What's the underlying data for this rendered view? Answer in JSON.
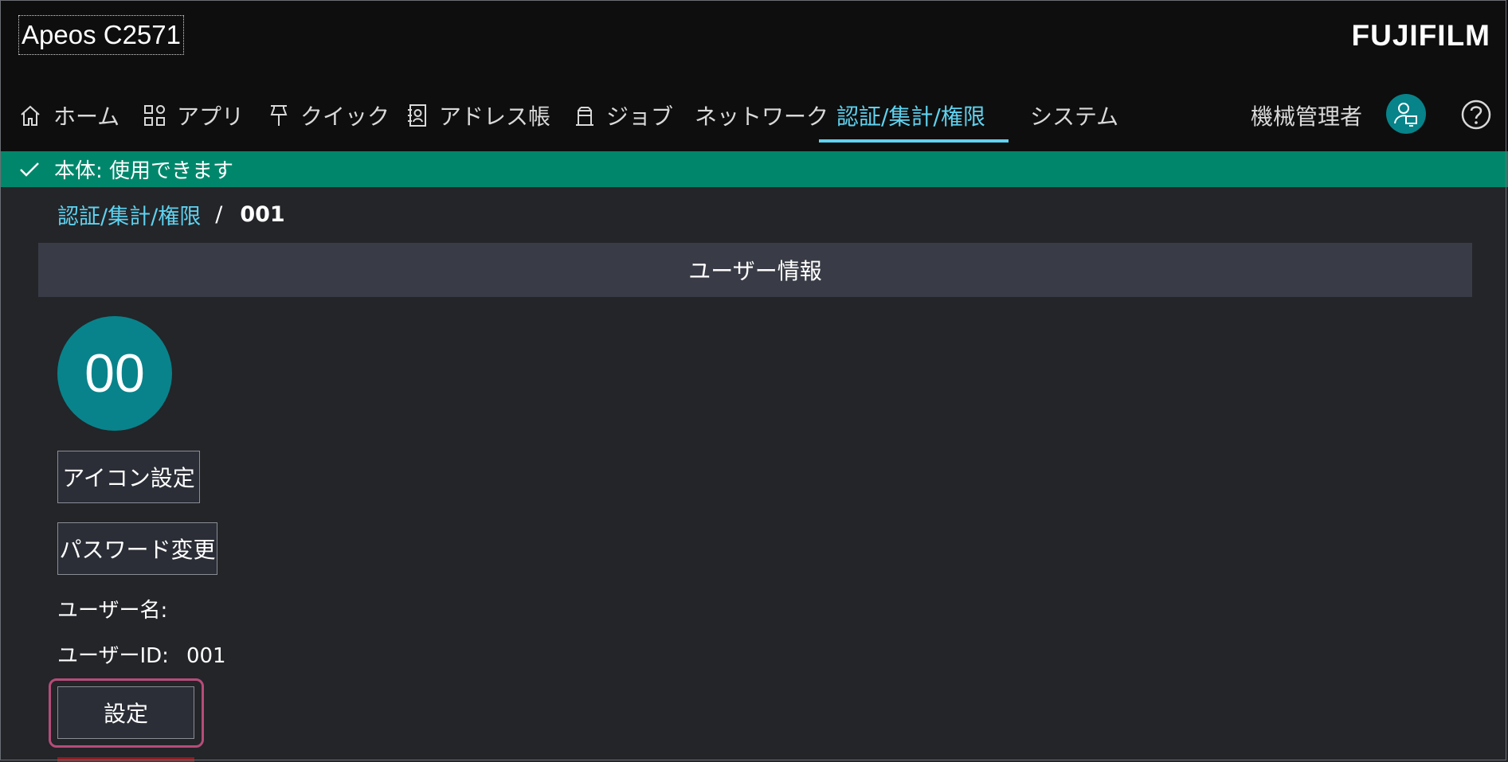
{
  "app": {
    "title": "Apeos C2571",
    "brand": "FUJIFILM"
  },
  "nav": {
    "items": [
      {
        "label": "ホーム",
        "icon": "home-icon"
      },
      {
        "label": "アプリ",
        "icon": "apps-icon"
      },
      {
        "label": "クイック",
        "icon": "pin-icon"
      },
      {
        "label": "アドレス帳",
        "icon": "address-book-icon"
      },
      {
        "label": "ジョブ",
        "icon": "job-icon"
      },
      {
        "label": "ネットワーク"
      },
      {
        "label": "認証/集計/権限",
        "active": true
      },
      {
        "label": "システム"
      }
    ],
    "admin_label": "機械管理者"
  },
  "status": {
    "text": "本体: 使用できます",
    "color": "#00876b"
  },
  "breadcrumb": {
    "parent": "認証/集計/権限",
    "separator": "/",
    "current": "001"
  },
  "section": {
    "title": "ユーザー情報"
  },
  "user": {
    "avatar_text": "00",
    "icon_button": "アイコン設定",
    "password_button": "パスワード変更",
    "name_label": "ユーザー名:",
    "name_value": "",
    "id_label": "ユーザーID:",
    "id_value": "001",
    "settings_button": "設定"
  },
  "colors": {
    "accent": "#5fd2ef",
    "teal": "#08838b",
    "focus": "#b64c7a"
  }
}
